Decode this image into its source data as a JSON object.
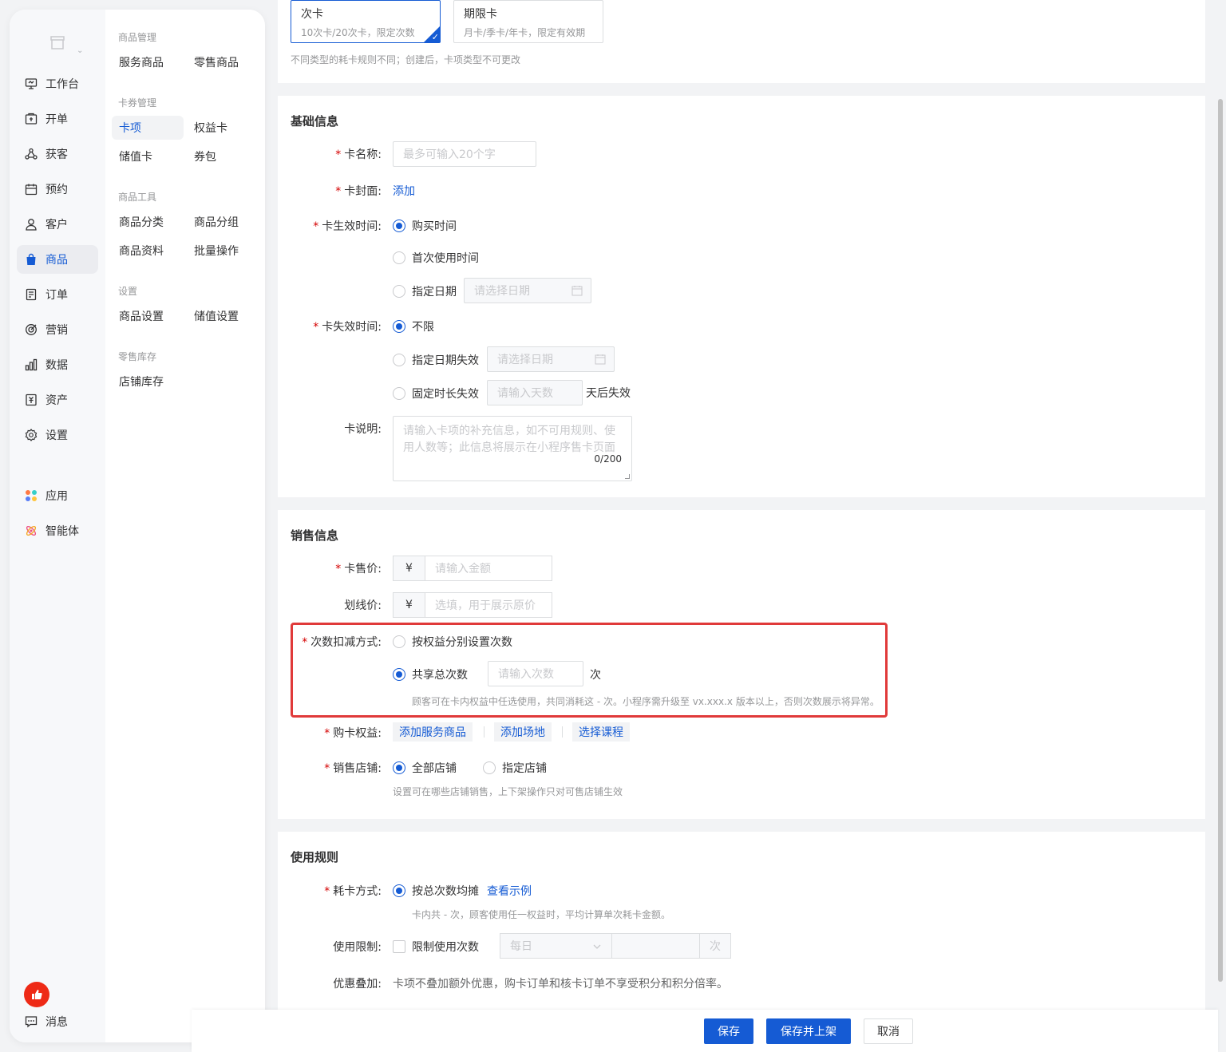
{
  "sidebar_primary": {
    "items": [
      {
        "label": "工作台",
        "icon": "workbench-icon"
      },
      {
        "label": "开单",
        "icon": "billing-icon"
      },
      {
        "label": "获客",
        "icon": "acquire-icon"
      },
      {
        "label": "预约",
        "icon": "calendar-icon"
      },
      {
        "label": "客户",
        "icon": "user-icon"
      },
      {
        "label": "商品",
        "icon": "bag-icon",
        "active": true
      },
      {
        "label": "订单",
        "icon": "order-icon"
      },
      {
        "label": "营销",
        "icon": "target-icon"
      },
      {
        "label": "数据",
        "icon": "chart-icon"
      },
      {
        "label": "资产",
        "icon": "asset-icon"
      },
      {
        "label": "设置",
        "icon": "gear-icon"
      }
    ],
    "apps": {
      "label": "应用",
      "icon": "apps-icon"
    },
    "agent": {
      "label": "智能体",
      "icon": "agent-icon"
    },
    "messages": {
      "label": "消息",
      "icon": "message-icon"
    }
  },
  "sidebar_secondary": {
    "groups": [
      {
        "title": "商品管理",
        "items": [
          "服务商品",
          "零售商品"
        ]
      },
      {
        "title": "卡券管理",
        "items": [
          "卡项",
          "权益卡",
          "储值卡",
          "券包"
        ]
      },
      {
        "title": "商品工具",
        "items": [
          "商品分类",
          "商品分组",
          "商品资料",
          "批量操作"
        ]
      },
      {
        "title": "设置",
        "items": [
          "商品设置",
          "储值设置"
        ]
      },
      {
        "title": "零售库存",
        "items": [
          "店铺库存"
        ]
      }
    ],
    "active_item": "卡项"
  },
  "card_type": {
    "options": [
      {
        "title": "次卡",
        "desc": "10次卡/20次卡，限定次数",
        "selected": true
      },
      {
        "title": "期限卡",
        "desc": "月卡/季卡/年卡，限定有效期",
        "selected": false
      }
    ],
    "hint": "不同类型的耗卡规则不同；创建后，卡项类型不可更改"
  },
  "basic_info": {
    "title": "基础信息",
    "name": {
      "label": "卡名称:",
      "placeholder": "最多可输入20个字"
    },
    "cover": {
      "label": "卡封面:",
      "action": "添加"
    },
    "effective": {
      "label": "卡生效时间:",
      "options": [
        "购买时间",
        "首次使用时间",
        "指定日期"
      ],
      "selected": "购买时间",
      "date_placeholder": "请选择日期"
    },
    "expire": {
      "label": "卡失效时间:",
      "options": [
        "不限",
        "指定日期失效",
        "固定时长失效"
      ],
      "selected": "不限",
      "date_placeholder": "请选择日期",
      "days_placeholder": "请输入天数",
      "days_suffix": "天后失效"
    },
    "description": {
      "label": "卡说明:",
      "placeholder": "请输入卡项的补充信息，如不可用规则、使用人数等；此信息将展示在小程序售卡页面",
      "count": "0/200"
    }
  },
  "sales_info": {
    "title": "销售信息",
    "price": {
      "label": "卡售价:",
      "currency": "¥",
      "placeholder": "请输入金额"
    },
    "strike_price": {
      "label": "划线价:",
      "currency": "¥",
      "placeholder": "选填，用于展示原价"
    },
    "deduction": {
      "label": "次数扣减方式:",
      "options": [
        "按权益分别设置次数",
        "共享总次数"
      ],
      "selected": "共享总次数",
      "count_placeholder": "请输入次数",
      "count_unit": "次",
      "hint": "顾客可在卡内权益中任选使用，共同消耗这 - 次。小程序需升级至 vx.xxx.x 版本以上，否则次数展示将异常。"
    },
    "benefits": {
      "label": "购卡权益:",
      "actions": [
        "添加服务商品",
        "添加场地",
        "选择课程"
      ]
    },
    "stores": {
      "label": "销售店铺:",
      "options": [
        "全部店铺",
        "指定店铺"
      ],
      "selected": "全部店铺",
      "hint": "设置可在哪些店铺销售，上下架操作只对可售店铺生效"
    }
  },
  "usage_rules": {
    "title": "使用规则",
    "consume": {
      "label": "耗卡方式:",
      "option": "按总次数均摊",
      "link": "查看示例",
      "hint": "卡内共 - 次，顾客使用任一权益时，平均计算单次耗卡金额。"
    },
    "limit": {
      "label": "使用限制:",
      "checkbox": "限制使用次数",
      "period": "每日",
      "unit": "次"
    },
    "stacking": {
      "label": "优惠叠加:",
      "text": "卡项不叠加额外优惠，购卡订单和核卡订单不享受积分和积分倍率。"
    }
  },
  "footer": {
    "save": "保存",
    "save_publish": "保存并上架",
    "cancel": "取消"
  },
  "colors": {
    "accent": "#155bd4",
    "required": "#d40000",
    "highlight_border": "#e03a3a",
    "badge": "#ee2a16"
  }
}
